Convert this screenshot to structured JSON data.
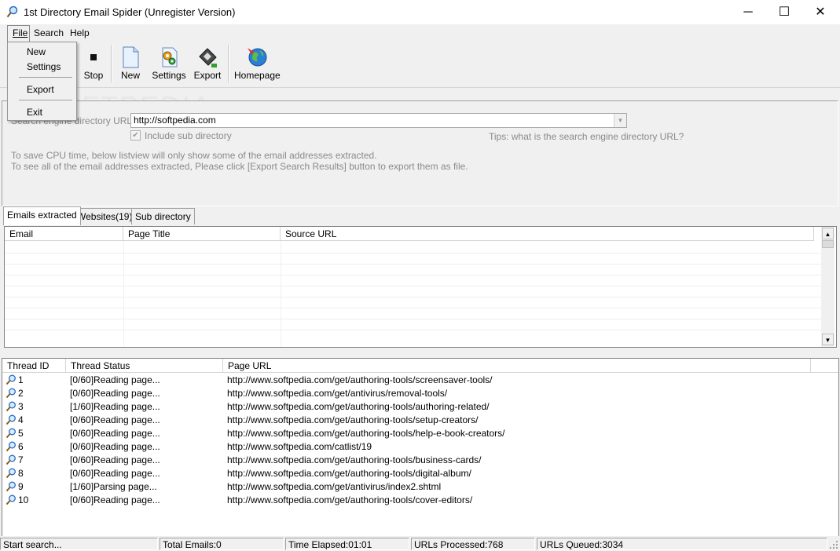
{
  "window": {
    "title": "1st Directory Email Spider (Unregister Version)",
    "minimize": "─",
    "maximize": "☐",
    "close": "✕"
  },
  "menubar": {
    "file": "File",
    "search": "Search",
    "help": "Help"
  },
  "file_menu": {
    "items": [
      "New",
      "Settings",
      "Export",
      "Exit"
    ]
  },
  "toolbar": {
    "stop": "Stop",
    "new": "New",
    "settings": "Settings",
    "export": "Export",
    "homepage": "Homepage"
  },
  "settings_panel": {
    "url_label": "Search engine directory URL:",
    "url_value": "http://softpedia.com",
    "include_sub": "Include sub directory",
    "include_sub_checked": true,
    "tips": "Tips: what is the search engine directory URL?",
    "note1": "To save CPU time, below listview will only show some of the email addresses extracted.",
    "note2": "To see all of the email addresses extracted, Please click [Export Search Results] button to export them as file."
  },
  "tabs": [
    "Emails extracted",
    "Websites(19)",
    "Sub directory"
  ],
  "email_list": {
    "columns": [
      "Email",
      "Page Title",
      "Source URL"
    ]
  },
  "thread_list": {
    "columns": [
      "Thread ID",
      "Thread Status",
      "Page URL"
    ],
    "rows": [
      {
        "id": "1",
        "status": "[0/60]Reading page...",
        "url": "http://www.softpedia.com/get/authoring-tools/screensaver-tools/"
      },
      {
        "id": "2",
        "status": "[0/60]Reading page...",
        "url": "http://www.softpedia.com/get/antivirus/removal-tools/"
      },
      {
        "id": "3",
        "status": "[1/60]Reading page...",
        "url": "http://www.softpedia.com/get/authoring-tools/authoring-related/"
      },
      {
        "id": "4",
        "status": "[0/60]Reading page...",
        "url": "http://www.softpedia.com/get/authoring-tools/setup-creators/"
      },
      {
        "id": "5",
        "status": "[0/60]Reading page...",
        "url": "http://www.softpedia.com/get/authoring-tools/help-e-book-creators/"
      },
      {
        "id": "6",
        "status": "[0/60]Reading page...",
        "url": "http://www.softpedia.com/catlist/19"
      },
      {
        "id": "7",
        "status": "[0/60]Reading page...",
        "url": "http://www.softpedia.com/get/authoring-tools/business-cards/"
      },
      {
        "id": "8",
        "status": "[0/60]Reading page...",
        "url": "http://www.softpedia.com/get/authoring-tools/digital-album/"
      },
      {
        "id": "9",
        "status": "[1/60]Parsing page...",
        "url": "http://www.softpedia.com/get/antivirus/index2.shtml"
      },
      {
        "id": "10",
        "status": "[0/60]Reading page...",
        "url": "http://www.softpedia.com/get/authoring-tools/cover-editors/"
      }
    ]
  },
  "statusbar": {
    "status": "Start search...",
    "total_emails": "Total Emails:0",
    "time_elapsed": "Time Elapsed:01:01",
    "urls_processed": "URLs Processed:768",
    "urls_queued": "URLs Queued:3034"
  },
  "watermark": "SOFTPEDIA"
}
